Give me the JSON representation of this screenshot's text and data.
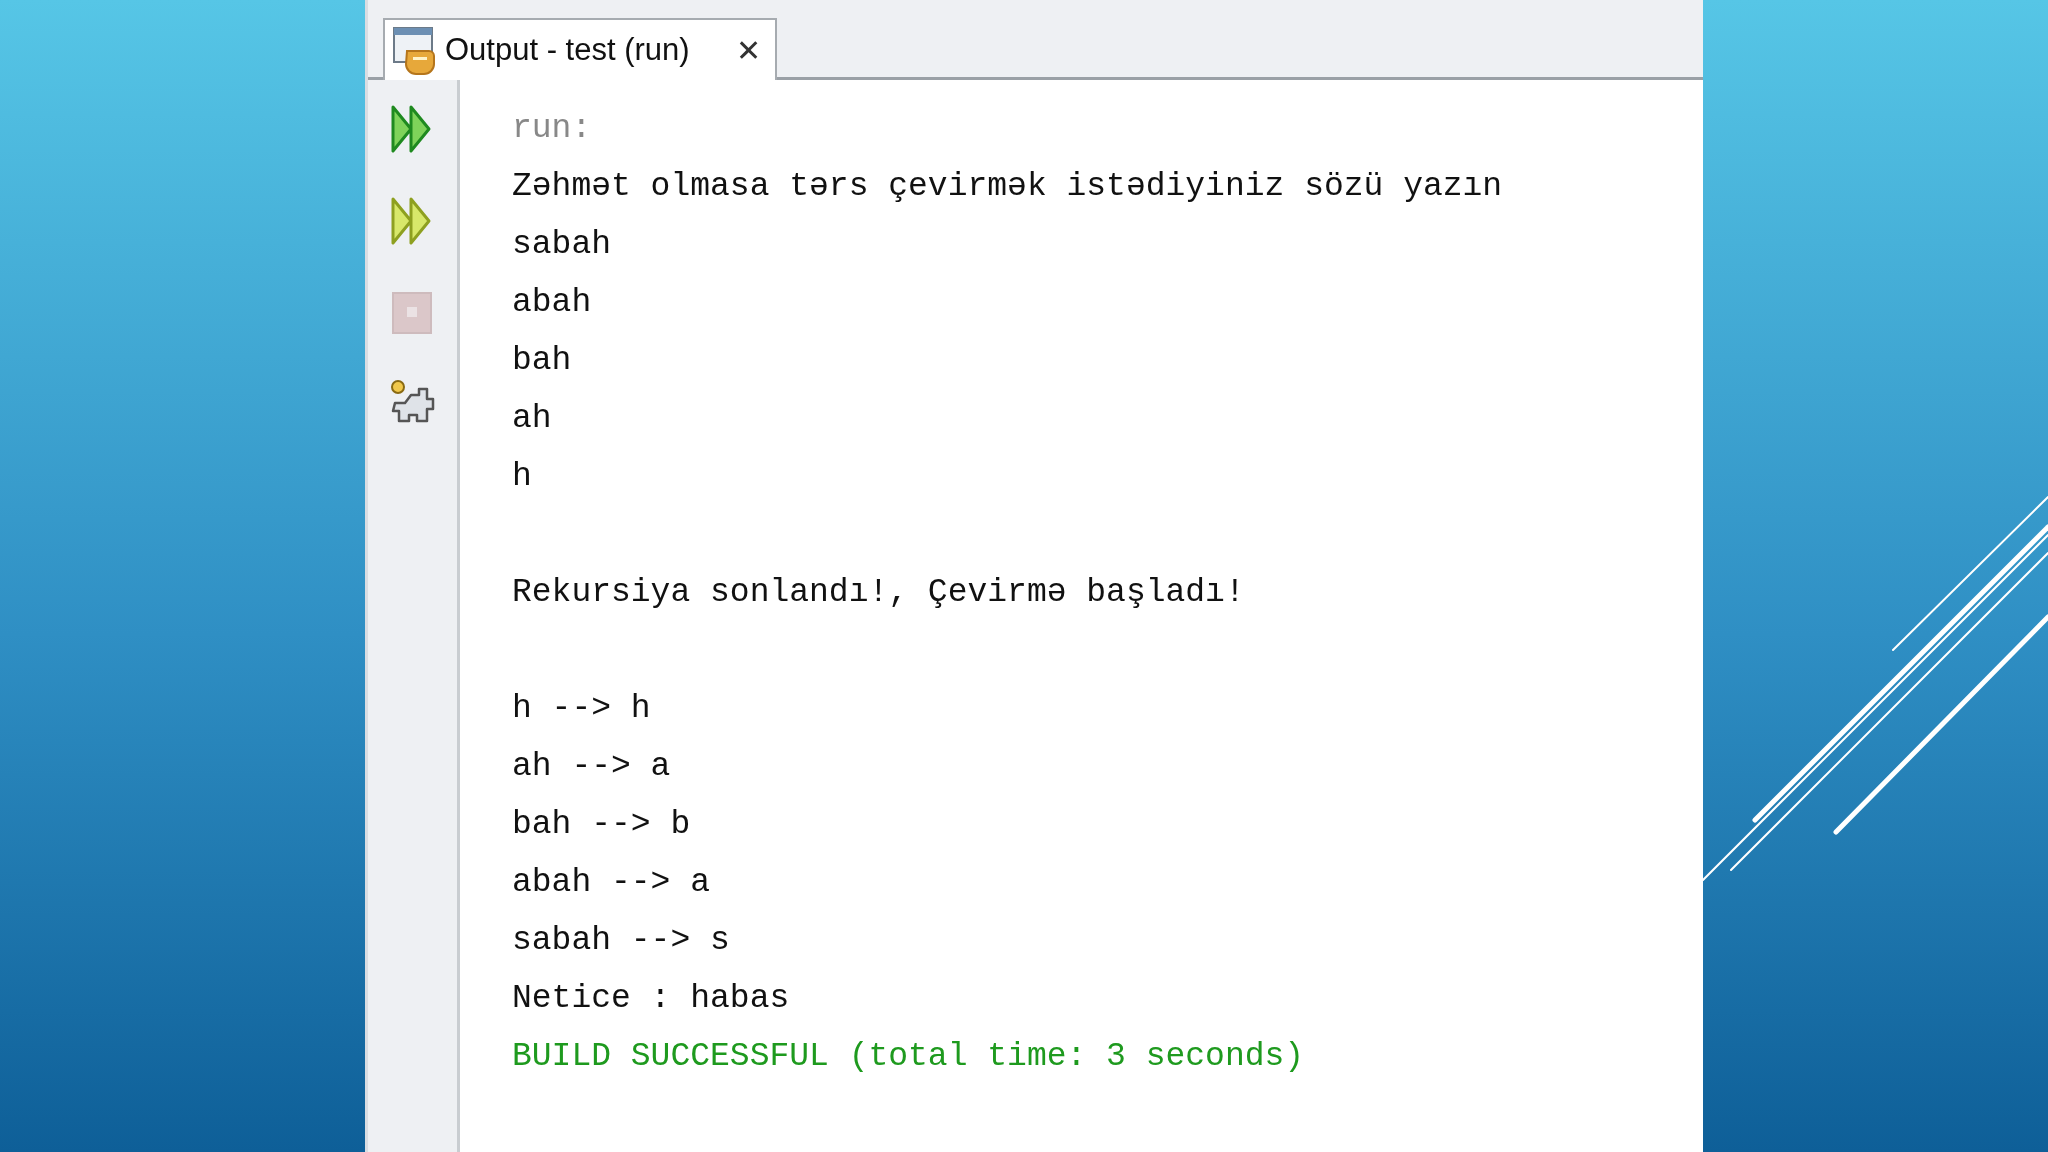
{
  "tab": {
    "title": "Output - test (run)",
    "close": "✕",
    "selected": true
  },
  "toolbar": [
    {
      "kind": "rerun",
      "disabled": false
    },
    {
      "kind": "rerun_options",
      "disabled": false
    },
    {
      "kind": "stop",
      "disabled": true
    },
    {
      "kind": "settings",
      "disabled": false
    }
  ],
  "lines": [
    {
      "text": "run:",
      "kind": "meta"
    },
    {
      "text": "Zəhmət olmasa tərs çevirmək istədiyiniz sözü yazın",
      "kind": "output"
    },
    {
      "text": "sabah",
      "kind": "output"
    },
    {
      "text": "abah",
      "kind": "output"
    },
    {
      "text": "bah",
      "kind": "output"
    },
    {
      "text": "ah",
      "kind": "output"
    },
    {
      "text": "h",
      "kind": "output"
    },
    {
      "kind": "blank"
    },
    {
      "text": "Rekursiya sonlandı!, Çevirmə başladı!",
      "kind": "output"
    },
    {
      "kind": "blank"
    },
    {
      "text": "h --> h",
      "kind": "output"
    },
    {
      "text": "ah --> a",
      "kind": "output"
    },
    {
      "text": "bah --> b",
      "kind": "output"
    },
    {
      "text": "abah --> a",
      "kind": "output"
    },
    {
      "text": "sabah --> s",
      "kind": "output"
    },
    {
      "text": "Netice : habas",
      "kind": "output"
    },
    {
      "text": "BUILD SUCCESSFUL (total time: 3 seconds)",
      "kind": "success"
    }
  ]
}
